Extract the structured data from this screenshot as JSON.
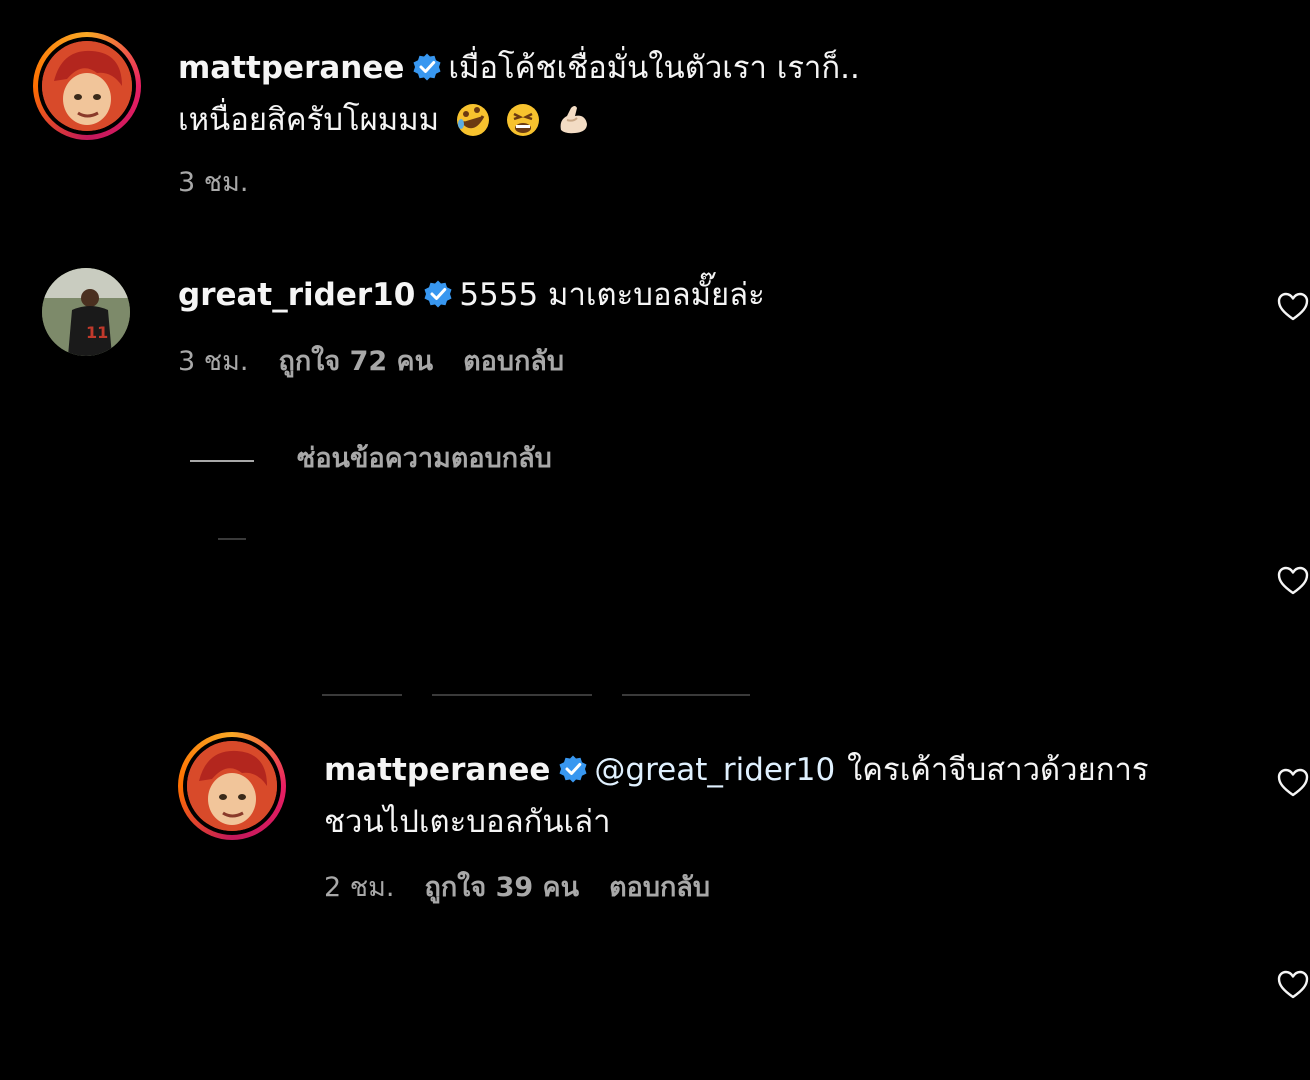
{
  "comments": [
    {
      "username": "mattperanee",
      "text_line1": "เมื่อโค้ชเชื่อมั่นในตัวเรา เราก็..",
      "text_line2": "เหนื่อยสิครับโผมมม",
      "emojis": [
        "rolling-on-floor-laughing-emoji",
        "tired-face-emoji",
        "flexed-biceps-emoji"
      ],
      "time": "3 ชม."
    },
    {
      "username": "great_rider10",
      "text": "5555 มาเตะบอลมั๊ยล่ะ",
      "time": "3 ชม.",
      "likes": "ถูกใจ 72 คน",
      "reply_label": "ตอบกลับ",
      "hide_replies_label": "ซ่อนข้อความตอบกลับ"
    },
    {
      "username": "mattperanee",
      "mention": "@great_rider10",
      "text_line1": "ใครเค้าจีบสาวด้วยการ",
      "text_line2": "ชวนไปเตะบอลกันเล่า",
      "time": "2 ชม.",
      "likes": "ถูกใจ 39 คน",
      "reply_label": "ตอบกลับ"
    }
  ],
  "colors": {
    "background": "#000000",
    "text": "#f5f5f5",
    "secondary": "#a8a8a8",
    "verified": "#3897f0",
    "mention": "#e0f1ff"
  }
}
